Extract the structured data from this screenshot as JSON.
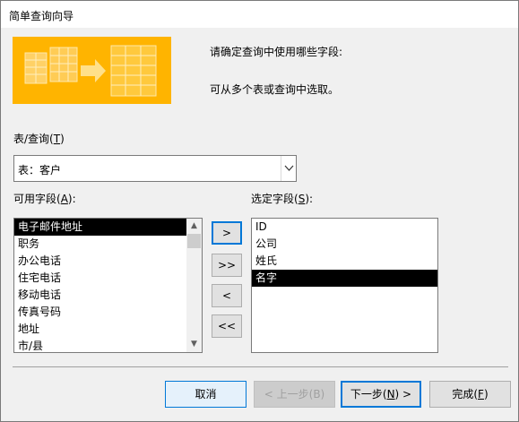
{
  "window": {
    "title": "简单查询向导"
  },
  "instructions": {
    "line1": "请确定查询中使用哪些字段:",
    "line2": "可从多个表或查询中选取。"
  },
  "table_selector": {
    "label": "表/查询(",
    "label_key": "T",
    "label_end": ")",
    "value": "表：客户",
    "dropdown_icon": "chevron-down-icon"
  },
  "available_fields": {
    "label": "可用字段(",
    "label_key": "A",
    "label_end": "):",
    "items": [
      "电子邮件地址",
      "职务",
      "办公电话",
      "住宅电话",
      "移动电话",
      "传真号码",
      "地址",
      "市/县"
    ],
    "selected_index": 0
  },
  "selected_fields": {
    "label": "选定字段(",
    "label_key": "S",
    "label_end": "):",
    "items": [
      "ID",
      "公司",
      "姓氏",
      "名字"
    ],
    "selected_index": 3
  },
  "move_buttons": {
    "add_one": ">",
    "add_all": ">>",
    "remove_one": "<",
    "remove_all": "<<"
  },
  "footer": {
    "cancel": "取消",
    "back": "< 上一步(B)",
    "next_prefix": "下一步(",
    "next_key": "N",
    "next_suffix": ") >",
    "finish_prefix": "完成(",
    "finish_key": "F",
    "finish_suffix": ")"
  },
  "colors": {
    "banner": "#ffb400",
    "accent": "#0078d7",
    "selection": "#000000"
  }
}
